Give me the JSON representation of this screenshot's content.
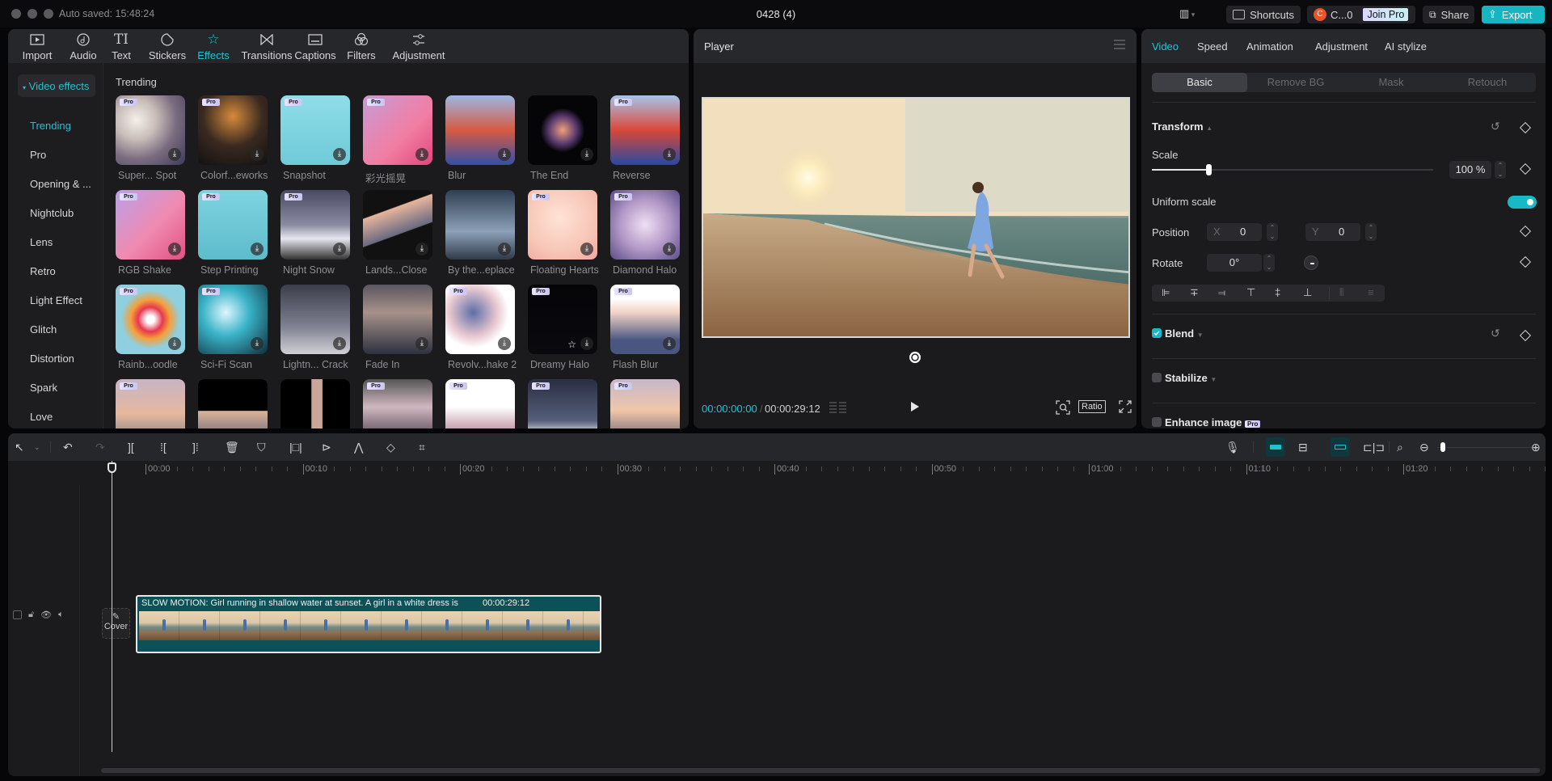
{
  "titlebar": {
    "auto_saved": "Auto saved: 15:48:24",
    "document_title": "0428 (4)",
    "shortcuts_label": "Shortcuts",
    "account_label": "C...0",
    "account_initial": "C",
    "join_pro_label": "Join Pro",
    "share_label": "Share",
    "export_label": "Export"
  },
  "media_tabs": [
    {
      "label": "Import",
      "icon": "import-icon"
    },
    {
      "label": "Audio",
      "icon": "audio-icon"
    },
    {
      "label": "Text",
      "icon": "text-icon"
    },
    {
      "label": "Stickers",
      "icon": "stickers-icon"
    },
    {
      "label": "Effects",
      "icon": "effects-icon",
      "active": true
    },
    {
      "label": "Transitions",
      "icon": "transitions-icon"
    },
    {
      "label": "Captions",
      "icon": "captions-icon"
    },
    {
      "label": "Filters",
      "icon": "filters-icon"
    },
    {
      "label": "Adjustment",
      "icon": "adjustment-icon"
    }
  ],
  "effects": {
    "category_header": "Video effects",
    "categories": [
      "Trending",
      "Pro",
      "Opening & ...",
      "Nightclub",
      "Lens",
      "Retro",
      "Light Effect",
      "Glitch",
      "Distortion",
      "Spark",
      "Love"
    ],
    "active_category": "Trending",
    "section_title": "Trending",
    "items": [
      {
        "label": "Super... Spot",
        "pro": true
      },
      {
        "label": "Colorf...eworks",
        "pro": true
      },
      {
        "label": "Snapshot",
        "pro": true
      },
      {
        "label": "彩光摇晃",
        "pro": true
      },
      {
        "label": "Blur",
        "pro": false
      },
      {
        "label": "The End",
        "pro": false
      },
      {
        "label": "Reverse",
        "pro": true
      },
      {
        "label": "RGB Shake",
        "pro": true
      },
      {
        "label": "Step Printing",
        "pro": true
      },
      {
        "label": "Night Snow",
        "pro": true
      },
      {
        "label": "Lands...Close",
        "pro": false
      },
      {
        "label": "By the...eplace",
        "pro": false
      },
      {
        "label": "Floating Hearts",
        "pro": true
      },
      {
        "label": "Diamond Halo",
        "pro": true
      },
      {
        "label": "Rainb...oodle",
        "pro": true
      },
      {
        "label": "Sci-Fi Scan",
        "pro": true
      },
      {
        "label": "Lightn... Crack",
        "pro": false
      },
      {
        "label": "Fade In",
        "pro": false
      },
      {
        "label": "Revolv...hake 2",
        "pro": true
      },
      {
        "label": "Dreamy Halo",
        "pro": true,
        "favorite_icon": true
      },
      {
        "label": "Flash Blur",
        "pro": true
      },
      {
        "label": "",
        "pro": true
      },
      {
        "label": "",
        "pro": false
      },
      {
        "label": "",
        "pro": false
      },
      {
        "label": "",
        "pro": true
      },
      {
        "label": "",
        "pro": true
      },
      {
        "label": "",
        "pro": true
      },
      {
        "label": "",
        "pro": true
      }
    ]
  },
  "player": {
    "title": "Player",
    "current_time": "00:00:00:00",
    "total_time": "00:00:29:12",
    "ratio_label": "Ratio"
  },
  "properties": {
    "tabs": [
      "Video",
      "Speed",
      "Animation",
      "Adjustment",
      "AI stylize"
    ],
    "active_tab": "Video",
    "subtabs": [
      "Basic",
      "Remove BG",
      "Mask",
      "Retouch"
    ],
    "active_subtab": "Basic",
    "transform_label": "Transform",
    "scale_label": "Scale",
    "scale_value": "100 %",
    "scale_slider_fraction": 0.2,
    "uniform_scale_label": "Uniform scale",
    "uniform_scale_on": true,
    "position_label": "Position",
    "pos_x_label": "X",
    "pos_x_value": "0",
    "pos_y_label": "Y",
    "pos_y_value": "0",
    "rotate_label": "Rotate",
    "rotate_value": "0°",
    "blend_label": "Blend",
    "blend_checked": true,
    "stabilize_label": "Stabilize",
    "stabilize_checked": false,
    "enhance_label": "Enhance image",
    "enhance_pro": "Pro"
  },
  "timeline": {
    "ruler_labels": [
      "00:00",
      "00:10",
      "00:20",
      "00:30",
      "00:40",
      "00:50",
      "01:00",
      "01:10",
      "01:20"
    ],
    "cover_label": "Cover",
    "clip_title": "SLOW MOTION: Girl running in shallow water at sunset. A girl in a white dress is",
    "clip_duration": "00:00:29:12",
    "zoom_fraction": 0.03
  },
  "colors": {
    "accent": "#1fc3ce",
    "clip_bg": "#0d5158",
    "account_badge": "#e8542b"
  }
}
